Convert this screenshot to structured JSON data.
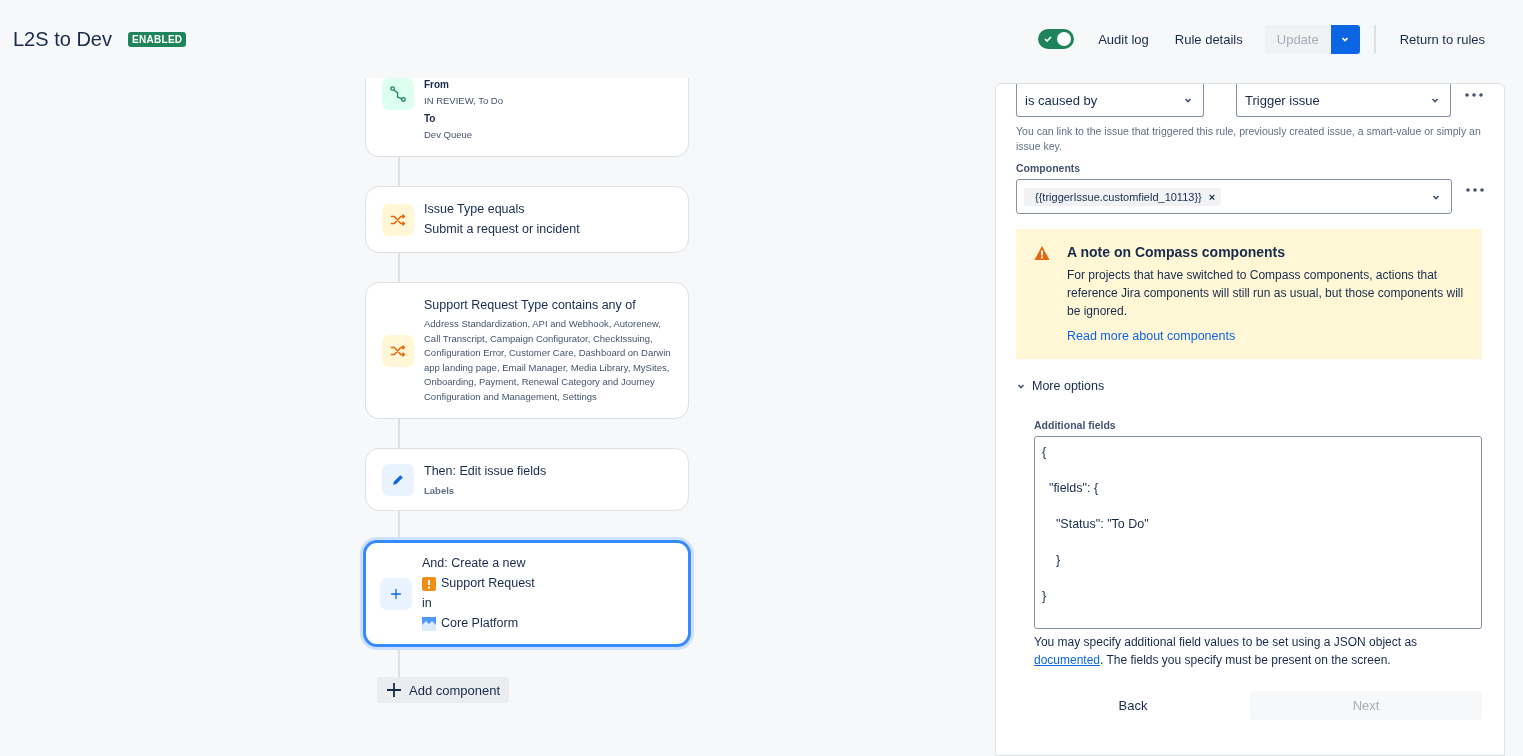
{
  "header": {
    "title": "L2S to Dev",
    "status_badge": "ENABLED",
    "rule_toggle": {
      "on": true
    },
    "audit_log": "Audit log",
    "rule_details": "Rule details",
    "update": {
      "label": "Update",
      "disabled": true
    },
    "return": "Return to rules"
  },
  "flow": {
    "cards": [
      {
        "kind": "transition",
        "selected": false,
        "lines": [
          {
            "kind": "label",
            "text": "From"
          },
          {
            "kind": "small",
            "text": "IN REVIEW, To Do"
          },
          {
            "kind": "label",
            "text": "To"
          },
          {
            "kind": "small",
            "text": "Dev Queue"
          }
        ]
      },
      {
        "kind": "condition",
        "selected": false,
        "lines": [
          {
            "kind": "title",
            "text": "Issue Type equals"
          },
          {
            "kind": "title",
            "text": "Submit a request or incident"
          }
        ]
      },
      {
        "kind": "condition",
        "selected": false,
        "lines": [
          {
            "kind": "title",
            "text": "Support Request Type contains any of"
          },
          {
            "kind": "small",
            "text": "Address Standardization, API and Webhook, Autorenew, Call Transcript, Campaign Configurator, CheckIssuing, Configuration Error, Customer Care, Dashboard on Darwin app landing page, Email Manager, Media Library, MySites, Onboarding, Payment, Renewal Category and Journey Configuration and Management, Settings"
          }
        ]
      },
      {
        "kind": "edit",
        "selected": false,
        "lines": [
          {
            "kind": "title",
            "text": "Then: Edit issue fields"
          },
          {
            "kind": "tag",
            "text": "Labels"
          }
        ]
      },
      {
        "kind": "create",
        "selected": true,
        "lines": [
          {
            "kind": "title",
            "text": "And: Create a new"
          },
          {
            "kind": "issue-type",
            "text": "Support Request"
          },
          {
            "kind": "title",
            "text": "in"
          },
          {
            "kind": "project",
            "text": "Core Platform"
          }
        ]
      }
    ],
    "add_component": "Add component"
  },
  "panel": {
    "link_type": "is caused by",
    "link_target": "Trigger issue",
    "link_help": "You can link to the issue that triggered this rule, previously created issue, a smart-value or simply an issue key.",
    "components_label": "Components",
    "components_value": "{{triggerIssue.customfield_10113}}",
    "remove_chip": "×",
    "note": {
      "title": "A note on Compass components",
      "body": "For projects that have switched to Compass components, actions that reference Jira components will still run as usual, but those components will be ignored.",
      "link": "Read more about components"
    },
    "more_options": {
      "label": "More options",
      "expanded": true
    },
    "additional_label": "Additional fields",
    "additional_value": "{\n\n  \"fields\": {\n\n    \"Status\": \"To Do\"\n\n    }\n\n}",
    "help_before": "You may specify additional field values to be set using a JSON object as",
    "help_link": "documented",
    "help_after": ". The fields you specify must be present on the screen.",
    "back": "Back",
    "next": {
      "label": "Next",
      "disabled": true
    }
  }
}
